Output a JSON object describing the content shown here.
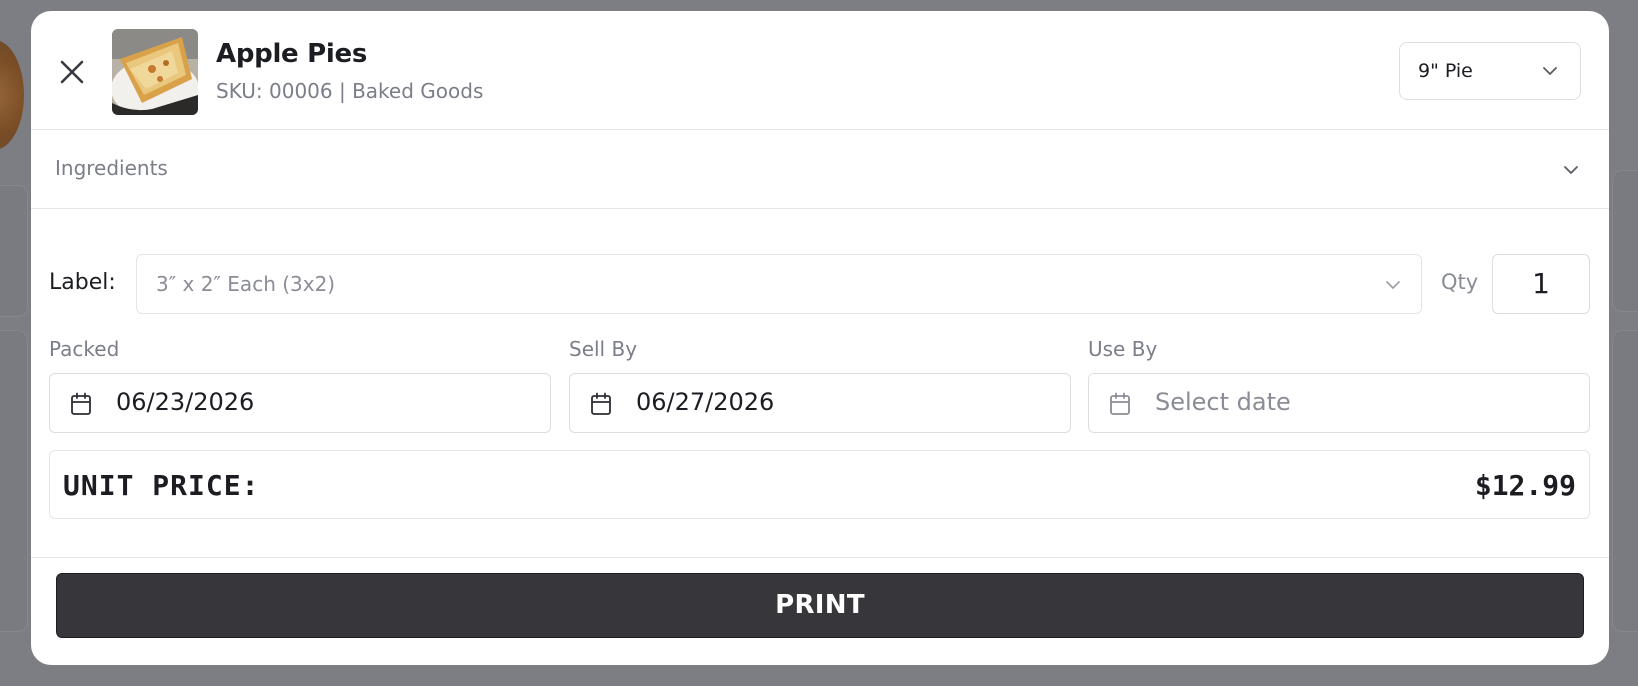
{
  "product": {
    "name": "Apple Pies",
    "subtitle": "SKU: 00006 | Baked Goods",
    "thumbnail_icon": "apple-pie-photo"
  },
  "size_select": {
    "value": "9\" Pie"
  },
  "ingredients": {
    "label": "Ingredients"
  },
  "label_row": {
    "label": "Label:",
    "selected": "3″ x 2″ Each (3x2)",
    "qty_label": "Qty",
    "qty_value": "1"
  },
  "dates": {
    "packed": {
      "label": "Packed",
      "value": "06/23/2026"
    },
    "sell_by": {
      "label": "Sell By",
      "value": "06/27/2026"
    },
    "use_by": {
      "label": "Use By",
      "placeholder": "Select date"
    }
  },
  "price": {
    "label": "UNIT PRICE:",
    "value": "$12.99"
  },
  "actions": {
    "print_label": "PRINT"
  },
  "colors": {
    "overlay": "#7c7e83",
    "primary_button": "#37363b",
    "text_primary": "#1c1d22",
    "text_muted": "#7b7e88",
    "border": "#dcdee3"
  }
}
